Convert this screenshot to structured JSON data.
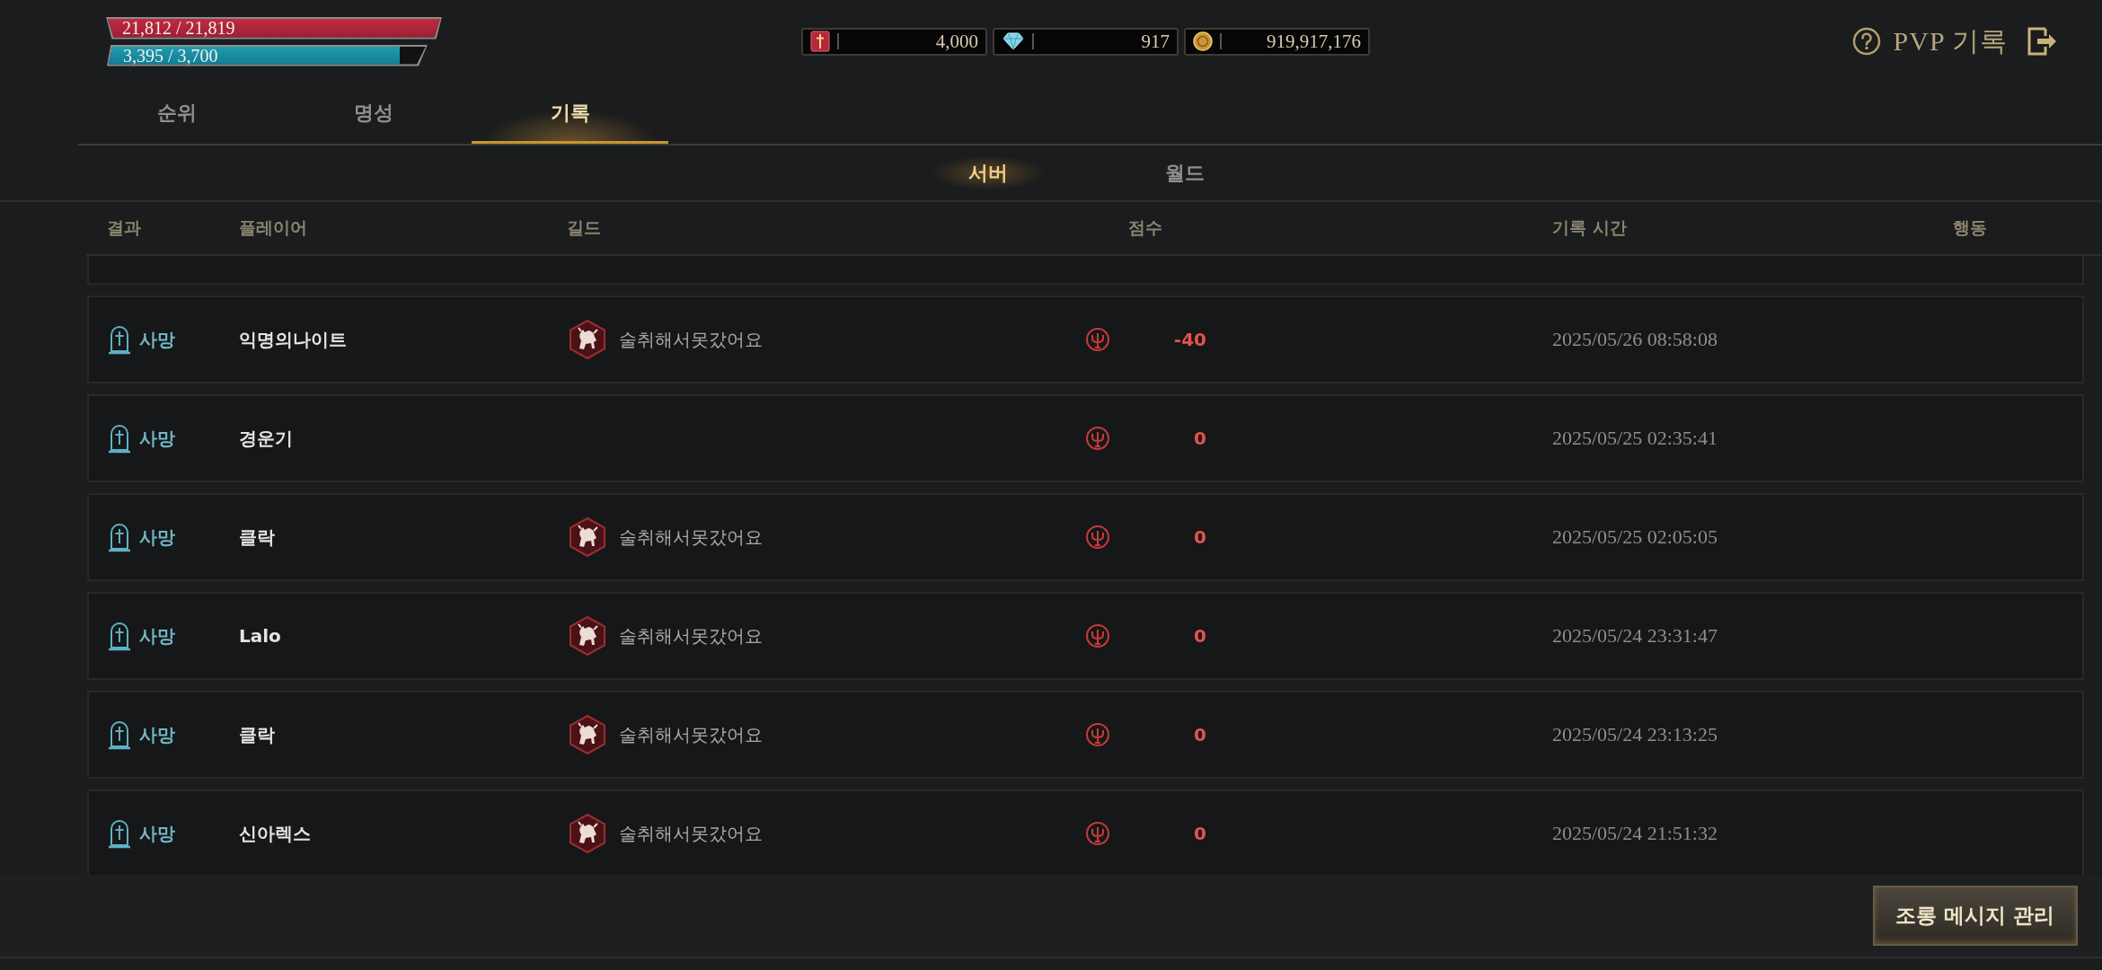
{
  "vitals": [
    {
      "kind": "health",
      "reading": "21,812 / 21,819",
      "level": 0.9997
    },
    {
      "kind": "mana",
      "reading": "3,395 / 3,700",
      "level": 0.918
    }
  ],
  "currencies": [
    {
      "kind": "token",
      "amount": "4,000"
    },
    {
      "kind": "gem",
      "amount": "917"
    },
    {
      "kind": "gold",
      "amount": "919,917,176"
    }
  ],
  "header": {
    "title": "PVP 기록"
  },
  "tabs": [
    {
      "label": "순위",
      "selected": false
    },
    {
      "label": "명성",
      "selected": false
    },
    {
      "label": "기록",
      "selected": true
    }
  ],
  "sub_tabs": [
    {
      "label": "서버",
      "selected": true
    },
    {
      "label": "월드",
      "selected": false
    }
  ],
  "table": {
    "columns": [
      "결과",
      "플레이어",
      "길드",
      "점수",
      "기록 시간",
      "행동"
    ],
    "rows": [
      {
        "result": {
          "kind": "death",
          "label": "사망"
        },
        "player": "익명의나이트",
        "guild": "술취해서못갔어요",
        "score": "-40",
        "time": "2025/05/26 08:58:08"
      },
      {
        "result": {
          "kind": "death",
          "label": "사망"
        },
        "player": "경운기",
        "score": "0",
        "time": "2025/05/25 02:35:41"
      },
      {
        "result": {
          "kind": "death",
          "label": "사망"
        },
        "player": "클락",
        "guild": "술취해서못갔어요",
        "score": "0",
        "time": "2025/05/25 02:05:05"
      },
      {
        "result": {
          "kind": "death",
          "label": "사망"
        },
        "player": "Lalo",
        "guild": "술취해서못갔어요",
        "score": "0",
        "time": "2025/05/24 23:31:47"
      },
      {
        "result": {
          "kind": "death",
          "label": "사망"
        },
        "player": "클락",
        "guild": "술취해서못갔어요",
        "score": "0",
        "time": "2025/05/24 23:13:25"
      },
      {
        "result": {
          "kind": "death",
          "label": "사망"
        },
        "player": "신아렉스",
        "guild": "술취해서못갔어요",
        "score": "0",
        "time": "2025/05/24 21:51:32"
      }
    ]
  },
  "buttons": [
    {
      "label": "조롱 메시지 관리"
    }
  ]
}
